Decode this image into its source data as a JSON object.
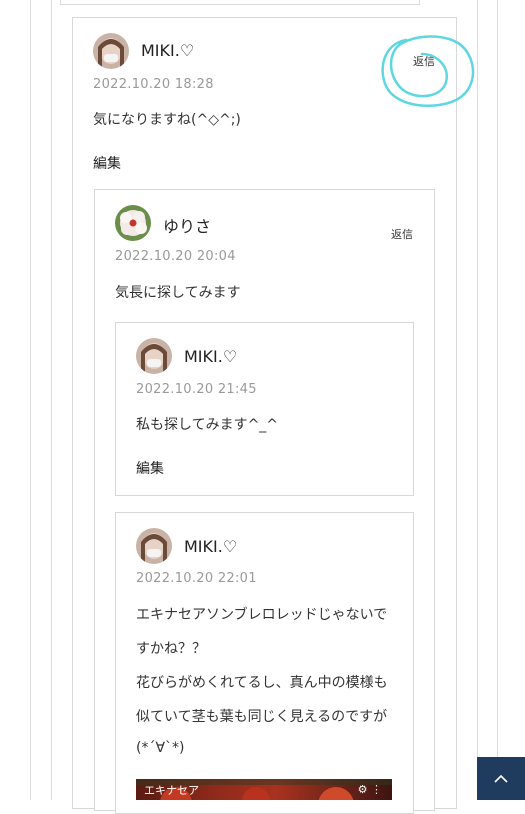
{
  "comments": [
    {
      "author": "MIKI.♡",
      "date": "2022.10.20 18:28",
      "text": "気になりますね(^◇^;)",
      "edit_label": "編集",
      "reply_label": "返信",
      "avatar_icon": "user-avatar-icon"
    },
    {
      "author": "ゆりさ",
      "date": "2022.10.20 20:04",
      "text": "気長に探してみます",
      "reply_label": "返信",
      "avatar_icon": "flower-avatar-icon"
    },
    {
      "author": "MIKI.♡",
      "date": "2022.10.20 21:45",
      "text": "私も探してみます^_^",
      "edit_label": "編集",
      "avatar_icon": "user-avatar-icon"
    },
    {
      "author": "MIKI.♡",
      "date": "2022.10.20 22:01",
      "lines": [
        "エキナセアソンブレロレッドじゃないで",
        "すかね？？",
        "花びらがめくれてるし、真ん中の模様も",
        "似ていて茎も葉も同じく見えるのですが",
        "(*´∀`*)"
      ],
      "avatar_icon": "user-avatar-icon",
      "photo_label": "エキナセア"
    }
  ],
  "scroll_top_icon": "chevron-up-icon",
  "colors": {
    "accent_navy": "#1f3c5f",
    "annotation_cyan": "#5fd6e2"
  }
}
